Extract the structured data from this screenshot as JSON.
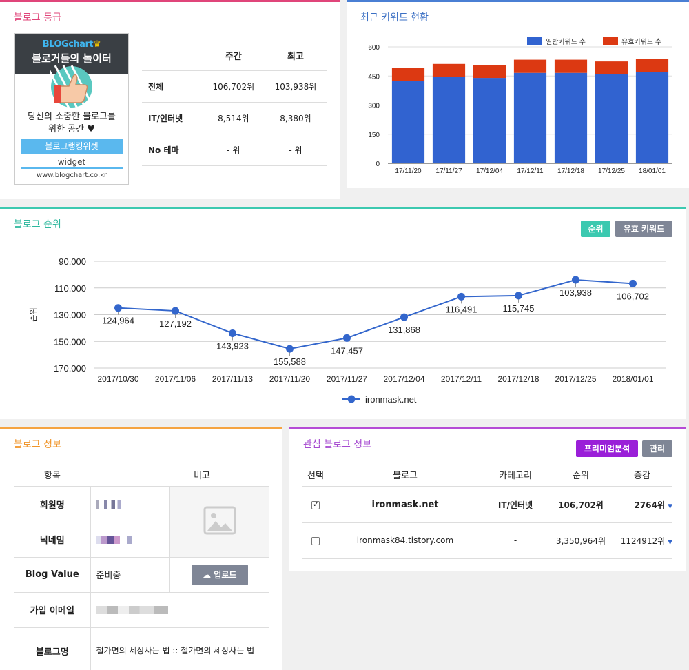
{
  "grade": {
    "title": "블로그 등급",
    "widget": {
      "logo": "BLOGchart",
      "slogan": "블로거들의 놀이터",
      "desc_line1": "당신의 소중한 블로그를",
      "desc_line2": "위한 공간 ♥",
      "button": "블로그랭킹위젯",
      "sub": "widget",
      "url": "www.blogchart.co.kr"
    },
    "headers": [
      "",
      "주간",
      "최고"
    ],
    "rows": [
      {
        "label": "전체",
        "weekly": "106,702위",
        "best": "103,938위"
      },
      {
        "label": "IT/인터넷",
        "weekly": "8,514위",
        "best": "8,380위"
      },
      {
        "label": "No 테마",
        "weekly": "- 위",
        "best": "- 위"
      }
    ]
  },
  "keyword": {
    "title": "최근 키워드 현황",
    "colors": {
      "normal": "#3163d0",
      "paid": "#dc3912"
    }
  },
  "rank": {
    "title": "블로그 순위",
    "btn_rank": "순위",
    "btn_paid": "유효 키워드",
    "colors": {
      "line": "#3366cc",
      "active": "#3cc9b0",
      "gray": "#7f8696"
    }
  },
  "info": {
    "title": "블로그 정보",
    "headers": [
      "항목",
      "비고"
    ],
    "rows": [
      {
        "label": "회원명",
        "value": ""
      },
      {
        "label": "닉네임",
        "value": ""
      },
      {
        "label": "Blog Value",
        "value": "준비중"
      },
      {
        "label": "가입 이메일",
        "value": ""
      },
      {
        "label": "블로그명",
        "value": "철가면의 세상사는 법 :: 철가면의 세상사는 법"
      }
    ],
    "upload": "업로드"
  },
  "fav": {
    "title": "관심 블로그 정보",
    "btn_premium": "프리미엄분석",
    "btn_manage": "관리",
    "headers": [
      "선택",
      "블로그",
      "카테고리",
      "순위",
      "증감"
    ],
    "rows": [
      {
        "checked": true,
        "blog": "ironmask.net",
        "category": "IT/인터넷",
        "rank": "106,702위",
        "change": "2764위"
      },
      {
        "checked": false,
        "blog": "ironmask84.tistory.com",
        "category": "-",
        "rank": "3,350,964위",
        "change": "1124912위"
      }
    ]
  },
  "chart_data": [
    {
      "type": "bar",
      "stacked": true,
      "categories": [
        "17/11/20",
        "17/11/27",
        "17/12/04",
        "17/12/11",
        "17/12/18",
        "17/12/25",
        "18/01/01"
      ],
      "series": [
        {
          "name": "일반키워드 수",
          "values": [
            425,
            446,
            440,
            466,
            466,
            460,
            472
          ]
        },
        {
          "name": "유효키워드 수",
          "values": [
            65,
            66,
            66,
            68,
            68,
            65,
            67
          ]
        }
      ],
      "yticks": [
        "0",
        "150",
        "300",
        "450",
        "600"
      ],
      "ylim": [
        0,
        600
      ],
      "grid": true,
      "legend": "top-right"
    },
    {
      "type": "line",
      "x": [
        "2017/10/30",
        "2017/11/06",
        "2017/11/13",
        "2017/11/20",
        "2017/11/27",
        "2017/12/04",
        "2017/12/11",
        "2017/12/18",
        "2017/12/25",
        "2018/01/01"
      ],
      "series": [
        {
          "name": "ironmask.net",
          "values": [
            124964,
            127192,
            143923,
            155588,
            147457,
            131868,
            116491,
            115745,
            103938,
            106702
          ],
          "labels": [
            "124,964",
            "127,192",
            "143,923",
            "155,588",
            "147,457",
            "131,868",
            "116,491",
            "115,745",
            "103,938",
            "106,702"
          ]
        }
      ],
      "ylabel": "순위",
      "yticks": [
        "90,000",
        "110,000",
        "130,000",
        "150,000",
        "170,000"
      ],
      "ylim": [
        90000,
        170000
      ],
      "reversed_y": true,
      "grid": true,
      "legend": "bottom"
    }
  ]
}
